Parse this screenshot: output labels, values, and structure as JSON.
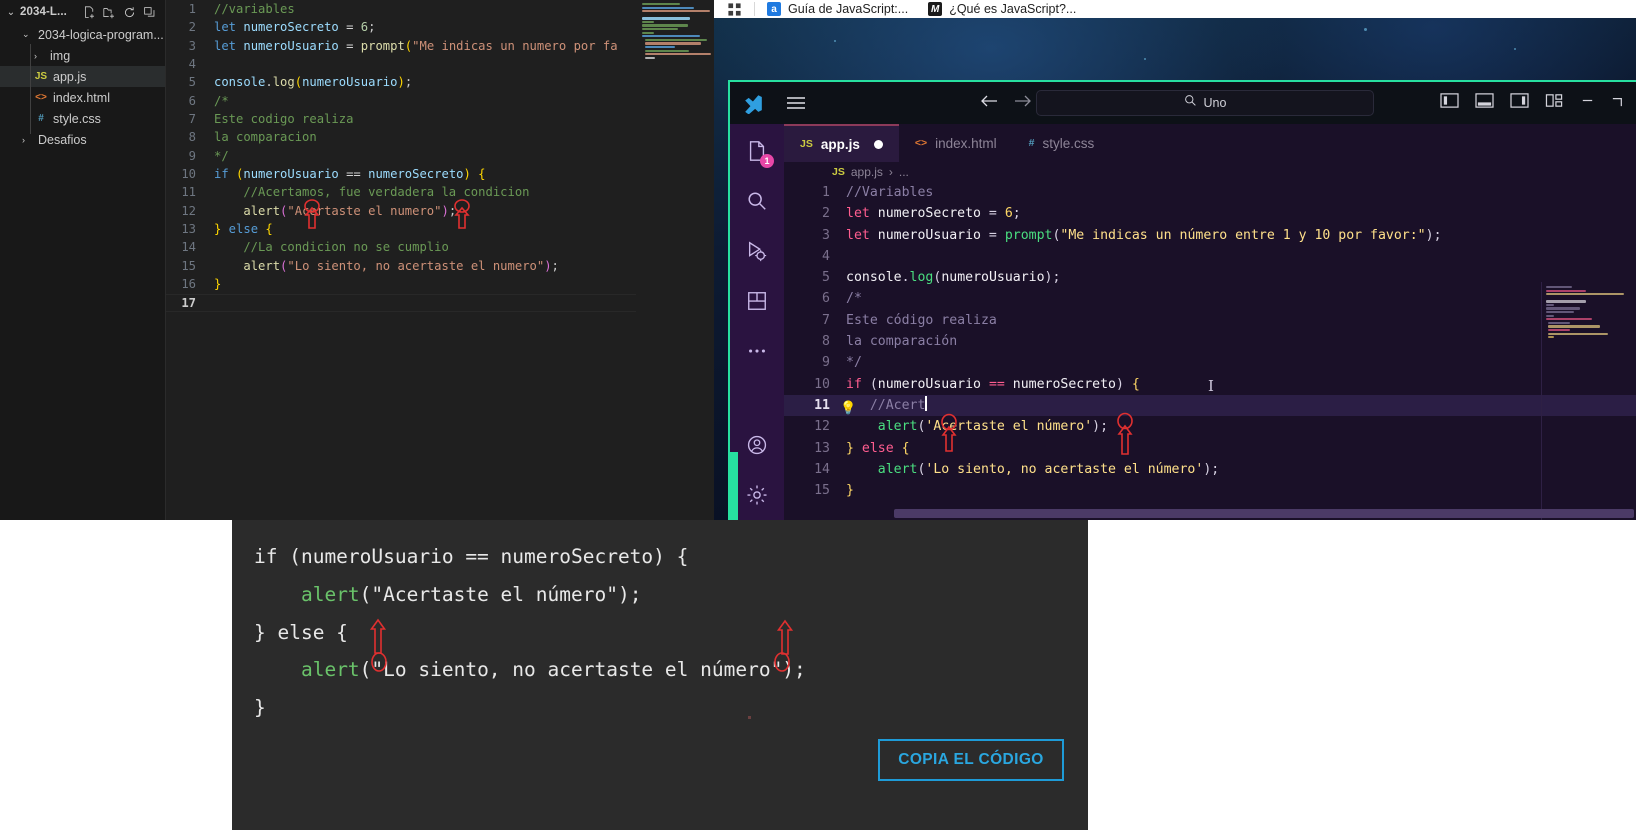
{
  "native_editor": {
    "sidebar": {
      "title": "2034-L...",
      "chevron": "⌄",
      "header_icons": [
        "new-file-icon",
        "new-folder-icon",
        "refresh-icon",
        "collapse-all-icon"
      ],
      "items": [
        {
          "label": "2034-logica-program...",
          "type": "folder-open",
          "indent": 1,
          "selected": false,
          "chevron": "⌄"
        },
        {
          "label": "img",
          "type": "folder",
          "indent": 2,
          "selected": false,
          "chevron": "›"
        },
        {
          "label": "app.js",
          "type": "js",
          "icon_text": "JS",
          "indent": 2,
          "selected": true
        },
        {
          "label": "index.html",
          "type": "html",
          "icon_text": "<>",
          "indent": 2,
          "selected": false
        },
        {
          "label": "style.css",
          "type": "css",
          "icon_text": "#",
          "indent": 2,
          "selected": false
        },
        {
          "label": "Desafios",
          "type": "folder",
          "indent": 1,
          "selected": false,
          "chevron": "›"
        }
      ]
    },
    "code_lines": [
      {
        "n": "1",
        "tokens": [
          {
            "t": "//variables",
            "c": "c-com"
          }
        ]
      },
      {
        "n": "2",
        "tokens": [
          {
            "t": "let ",
            "c": "c-kw"
          },
          {
            "t": "numeroSecreto",
            "c": "c-var"
          },
          {
            "t": " = ",
            "c": "c-op"
          },
          {
            "t": "6",
            "c": "c-num"
          },
          {
            "t": ";",
            "c": "c-pun"
          }
        ]
      },
      {
        "n": "3",
        "tokens": [
          {
            "t": "let ",
            "c": "c-kw"
          },
          {
            "t": "numeroUsuario",
            "c": "c-var"
          },
          {
            "t": " = ",
            "c": "c-op"
          },
          {
            "t": "prompt",
            "c": "c-fn"
          },
          {
            "t": "(",
            "c": "c-brk1"
          },
          {
            "t": "\"Me indicas un numero por fa",
            "c": "c-str"
          }
        ]
      },
      {
        "n": "4",
        "tokens": []
      },
      {
        "n": "5",
        "tokens": [
          {
            "t": "console",
            "c": "c-var"
          },
          {
            "t": ".",
            "c": "c-pun"
          },
          {
            "t": "log",
            "c": "c-fn"
          },
          {
            "t": "(",
            "c": "c-brk1"
          },
          {
            "t": "numeroUsuario",
            "c": "c-var"
          },
          {
            "t": ")",
            "c": "c-brk1"
          },
          {
            "t": ";",
            "c": "c-pun"
          }
        ]
      },
      {
        "n": "6",
        "tokens": [
          {
            "t": "/*",
            "c": "c-com"
          }
        ]
      },
      {
        "n": "7",
        "tokens": [
          {
            "t": "Este codigo realiza",
            "c": "c-com"
          }
        ]
      },
      {
        "n": "8",
        "tokens": [
          {
            "t": "la comparacion",
            "c": "c-com"
          }
        ]
      },
      {
        "n": "9",
        "tokens": [
          {
            "t": "*/",
            "c": "c-com"
          }
        ]
      },
      {
        "n": "10",
        "tokens": [
          {
            "t": "if ",
            "c": "c-kw"
          },
          {
            "t": "(",
            "c": "c-brk1"
          },
          {
            "t": "numeroUsuario",
            "c": "c-var"
          },
          {
            "t": " == ",
            "c": "c-op"
          },
          {
            "t": "numeroSecreto",
            "c": "c-var"
          },
          {
            "t": ")",
            "c": "c-brk1"
          },
          {
            "t": " {",
            "c": "c-brk1"
          }
        ]
      },
      {
        "n": "11",
        "tokens": [
          {
            "t": "    //Acertamos, fue verdadera la condicion",
            "c": "c-com"
          }
        ]
      },
      {
        "n": "12",
        "tokens": [
          {
            "t": "    ",
            "c": "c-pun"
          },
          {
            "t": "alert",
            "c": "c-fn"
          },
          {
            "t": "(",
            "c": "c-brk2"
          },
          {
            "t": "\"Acertaste el numero\"",
            "c": "c-str"
          },
          {
            "t": ")",
            "c": "c-brk2"
          },
          {
            "t": ";",
            "c": "c-pun"
          }
        ]
      },
      {
        "n": "13",
        "tokens": [
          {
            "t": "}",
            "c": "c-brk1"
          },
          {
            "t": " else ",
            "c": "c-kw"
          },
          {
            "t": "{",
            "c": "c-brk1"
          }
        ]
      },
      {
        "n": "14",
        "tokens": [
          {
            "t": "    //La condicion no se cumplio",
            "c": "c-com"
          }
        ]
      },
      {
        "n": "15",
        "tokens": [
          {
            "t": "    ",
            "c": "c-pun"
          },
          {
            "t": "alert",
            "c": "c-fn"
          },
          {
            "t": "(",
            "c": "c-brk2"
          },
          {
            "t": "\"Lo siento, no acertaste el numero\"",
            "c": "c-str"
          },
          {
            "t": ")",
            "c": "c-brk2"
          },
          {
            "t": ";",
            "c": "c-pun"
          }
        ]
      },
      {
        "n": "16",
        "tokens": [
          {
            "t": "}",
            "c": "c-brk1"
          }
        ]
      },
      {
        "n": "17",
        "tokens": []
      }
    ]
  },
  "browser": {
    "grid_icon": "tab-grid-icon",
    "tabs": [
      {
        "label": "Guía de JavaScript:...",
        "favicon_text": "a",
        "favicon_class": "fav-a"
      },
      {
        "label": "¿Qué es JavaScript?...",
        "favicon_text": "M",
        "favicon_class": "fav-m"
      }
    ]
  },
  "vscode_web": {
    "logo": "vscode-logo-icon",
    "menu_icon": "hamburger-menu-icon",
    "back_icon": "back-arrow-icon",
    "forward_icon": "forward-arrow-icon",
    "search": {
      "value": "Uno",
      "icon": "search-icon"
    },
    "layout_icons": [
      "toggle-primary-sidebar-icon",
      "toggle-panel-icon",
      "toggle-secondary-sidebar-icon",
      "customize-layout-icon"
    ],
    "window_controls": [
      "minimize-icon",
      "maximize-icon"
    ],
    "activity_items": [
      {
        "name": "explorer-icon",
        "badge": "1"
      },
      {
        "name": "search-icon",
        "badge": ""
      },
      {
        "name": "run-and-debug-icon",
        "badge": ""
      },
      {
        "name": "extensions-icon",
        "badge": ""
      },
      {
        "name": "more-views-icon",
        "badge": ""
      },
      {
        "name": "accounts-icon",
        "badge": ""
      },
      {
        "name": "settings-gear-icon",
        "badge": ""
      }
    ],
    "tabs": [
      {
        "label": "app.js",
        "icon_text": "JS",
        "icon_class": "ic-js",
        "active": true,
        "dirty": true
      },
      {
        "label": "index.html",
        "icon_text": "<>",
        "icon_class": "ic-html",
        "active": false,
        "dirty": false
      },
      {
        "label": "style.css",
        "icon_text": "#",
        "icon_class": "ic-css",
        "active": false,
        "dirty": false
      }
    ],
    "breadcrumb": {
      "file": "app.js",
      "icon_text": "JS",
      "separator": "›",
      "rest": "..."
    },
    "code_lines": [
      {
        "n": "1",
        "hl": false,
        "tokens": [
          {
            "t": "//Variables",
            "c": "vp-com"
          }
        ]
      },
      {
        "n": "2",
        "hl": false,
        "tokens": [
          {
            "t": "let ",
            "c": "vp-kw"
          },
          {
            "t": "numeroSecreto",
            "c": "vp-var"
          },
          {
            "t": " = ",
            "c": "vp-pun"
          },
          {
            "t": "6",
            "c": "vp-num"
          },
          {
            "t": ";",
            "c": "vp-pun"
          }
        ]
      },
      {
        "n": "3",
        "hl": false,
        "tokens": [
          {
            "t": "let ",
            "c": "vp-kw"
          },
          {
            "t": "numeroUsuario",
            "c": "vp-var"
          },
          {
            "t": " = ",
            "c": "vp-pun"
          },
          {
            "t": "prompt",
            "c": "vp-fn"
          },
          {
            "t": "(",
            "c": "vp-pun"
          },
          {
            "t": "\"Me indicas un número entre 1 y 10 por favor:\"",
            "c": "vp-str"
          },
          {
            "t": ")",
            "c": "vp-pun"
          },
          {
            "t": ";",
            "c": "vp-pun"
          }
        ]
      },
      {
        "n": "4",
        "hl": false,
        "tokens": []
      },
      {
        "n": "5",
        "hl": false,
        "tokens": [
          {
            "t": "console",
            "c": "vp-var"
          },
          {
            "t": ".",
            "c": "vp-pun"
          },
          {
            "t": "log",
            "c": "vp-fn"
          },
          {
            "t": "(",
            "c": "vp-pun"
          },
          {
            "t": "numeroUsuario",
            "c": "vp-var"
          },
          {
            "t": ")",
            "c": "vp-pun"
          },
          {
            "t": ";",
            "c": "vp-pun"
          }
        ]
      },
      {
        "n": "6",
        "hl": false,
        "tokens": [
          {
            "t": "/*",
            "c": "vp-com"
          }
        ]
      },
      {
        "n": "7",
        "hl": false,
        "tokens": [
          {
            "t": "Este código realiza",
            "c": "vp-com"
          }
        ]
      },
      {
        "n": "8",
        "hl": false,
        "tokens": [
          {
            "t": "la comparación",
            "c": "vp-com"
          }
        ]
      },
      {
        "n": "9",
        "hl": false,
        "tokens": [
          {
            "t": "*/",
            "c": "vp-com"
          }
        ]
      },
      {
        "n": "10",
        "hl": false,
        "tokens": [
          {
            "t": "if ",
            "c": "vp-kw"
          },
          {
            "t": "(",
            "c": "vp-pun"
          },
          {
            "t": "numeroUsuario",
            "c": "vp-var"
          },
          {
            "t": " == ",
            "c": "vp-kw"
          },
          {
            "t": "numeroSecreto",
            "c": "vp-var"
          },
          {
            "t": ")",
            "c": "vp-pun"
          },
          {
            "t": " {",
            "c": "vp-yel"
          }
        ]
      },
      {
        "n": "11",
        "hl": true,
        "bulb": true,
        "caret": true,
        "tokens": [
          {
            "t": "   //Acert",
            "c": "vp-com"
          }
        ]
      },
      {
        "n": "12",
        "hl": false,
        "tokens": [
          {
            "t": "    ",
            "c": "vp-pun"
          },
          {
            "t": "alert",
            "c": "vp-fn"
          },
          {
            "t": "(",
            "c": "vp-pun"
          },
          {
            "t": "'Acertaste el número'",
            "c": "vp-str"
          },
          {
            "t": ")",
            "c": "vp-pun"
          },
          {
            "t": ";",
            "c": "vp-pun"
          }
        ]
      },
      {
        "n": "13",
        "hl": false,
        "tokens": [
          {
            "t": "}",
            "c": "vp-yel"
          },
          {
            "t": " else ",
            "c": "vp-kw"
          },
          {
            "t": "{",
            "c": "vp-yel"
          }
        ]
      },
      {
        "n": "14",
        "hl": false,
        "tokens": [
          {
            "t": "    ",
            "c": "vp-pun"
          },
          {
            "t": "alert",
            "c": "vp-fn"
          },
          {
            "t": "(",
            "c": "vp-pun"
          },
          {
            "t": "'Lo siento, no acertaste el número'",
            "c": "vp-str"
          },
          {
            "t": ")",
            "c": "vp-pun"
          },
          {
            "t": ";",
            "c": "vp-pun"
          }
        ]
      },
      {
        "n": "15",
        "hl": false,
        "tokens": [
          {
            "t": "}",
            "c": "vp-yel"
          }
        ]
      }
    ]
  },
  "overlay_panel": {
    "code_lines": [
      {
        "tokens": [
          {
            "t": "if (numeroUsuario == numeroSecreto) {",
            "c": "ov-str"
          }
        ]
      },
      {
        "tokens": [
          {
            "t": "    ",
            "c": "ov-str"
          },
          {
            "t": "alert",
            "c": "ov-fn"
          },
          {
            "t": "(\"Acertaste el número\");",
            "c": "ov-str"
          }
        ]
      },
      {
        "tokens": [
          {
            "t": "} else {",
            "c": "ov-str"
          }
        ]
      },
      {
        "tokens": [
          {
            "t": "    ",
            "c": "ov-str"
          },
          {
            "t": "alert",
            "c": "ov-fn"
          },
          {
            "t": "(\"Lo siento, no acertaste el número\");",
            "c": "ov-str"
          }
        ]
      },
      {
        "tokens": [
          {
            "t": "}",
            "c": "ov-str"
          }
        ]
      }
    ],
    "copy_button": "COPIA EL CÓDIGO"
  },
  "colors": {
    "annotation_red": "#e03030",
    "accent_green": "#27e0a0",
    "button_blue": "#2aa7e0",
    "badge_pink": "#e847a8"
  }
}
